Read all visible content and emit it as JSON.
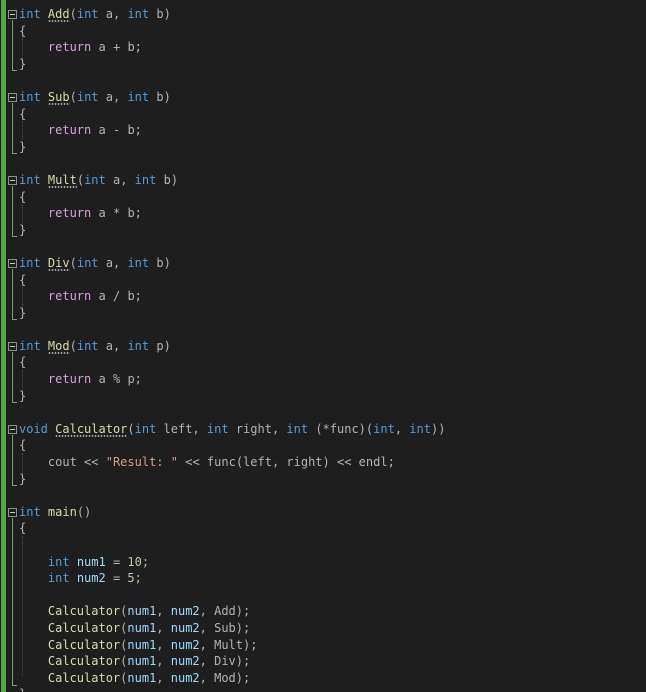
{
  "editor": {
    "functions": {
      "add": {
        "ret": "int",
        "name": "Add",
        "t1": "int",
        "p1": "a",
        "t2": "int",
        "p2": "b",
        "ret_kw": "return",
        "lhs": "a",
        "op": "+",
        "rhs": "b"
      },
      "sub": {
        "ret": "int",
        "name": "Sub",
        "t1": "int",
        "p1": "a",
        "t2": "int",
        "p2": "b",
        "ret_kw": "return",
        "lhs": "a",
        "op": "-",
        "rhs": "b"
      },
      "mult": {
        "ret": "int",
        "name": "Mult",
        "t1": "int",
        "p1": "a",
        "t2": "int",
        "p2": "b",
        "ret_kw": "return",
        "lhs": "a",
        "op": "*",
        "rhs": "b"
      },
      "div": {
        "ret": "int",
        "name": "Div",
        "t1": "int",
        "p1": "a",
        "t2": "int",
        "p2": "b",
        "ret_kw": "return",
        "lhs": "a",
        "op": "/",
        "rhs": "b"
      },
      "mod": {
        "ret": "int",
        "name": "Mod",
        "t1": "int",
        "p1": "a",
        "t2": "int",
        "p2": "p",
        "ret_kw": "return",
        "lhs": "a",
        "op": "%",
        "rhs": "p"
      }
    },
    "calculator": {
      "ret": "void",
      "name": "Calculator",
      "t1": "int",
      "p1": "left",
      "t2": "int",
      "p2": "right",
      "t3": "int",
      "fp": "(*func)",
      "ft1": "int",
      "ft2": "int",
      "cout": "cout",
      "shl": "<<",
      "str": "\"Result: \"",
      "call": "func",
      "a1": "left",
      "a2": "right",
      "endl": "endl"
    },
    "main": {
      "ret": "int",
      "name": "main",
      "decls": [
        {
          "type": "int",
          "name": "num1",
          "value": "10"
        },
        {
          "type": "int",
          "name": "num2",
          "value": "5"
        }
      ],
      "calls": [
        {
          "fn": "Calculator",
          "a1": "num1",
          "a2": "num2",
          "a3": "Add"
        },
        {
          "fn": "Calculator",
          "a1": "num1",
          "a2": "num2",
          "a3": "Sub"
        },
        {
          "fn": "Calculator",
          "a1": "num1",
          "a2": "num2",
          "a3": "Mult"
        },
        {
          "fn": "Calculator",
          "a1": "num1",
          "a2": "num2",
          "a3": "Div"
        },
        {
          "fn": "Calculator",
          "a1": "num1",
          "a2": "num2",
          "a3": "Mod"
        }
      ]
    },
    "colors": {
      "background": "#1e1e1e",
      "keyword": "#569cd6",
      "control": "#d8a0df",
      "function": "#dcdcaa",
      "variable": "#9cdcfe",
      "number": "#b5cea8",
      "string": "#d69d85",
      "change_bar": "#57a64a"
    }
  }
}
